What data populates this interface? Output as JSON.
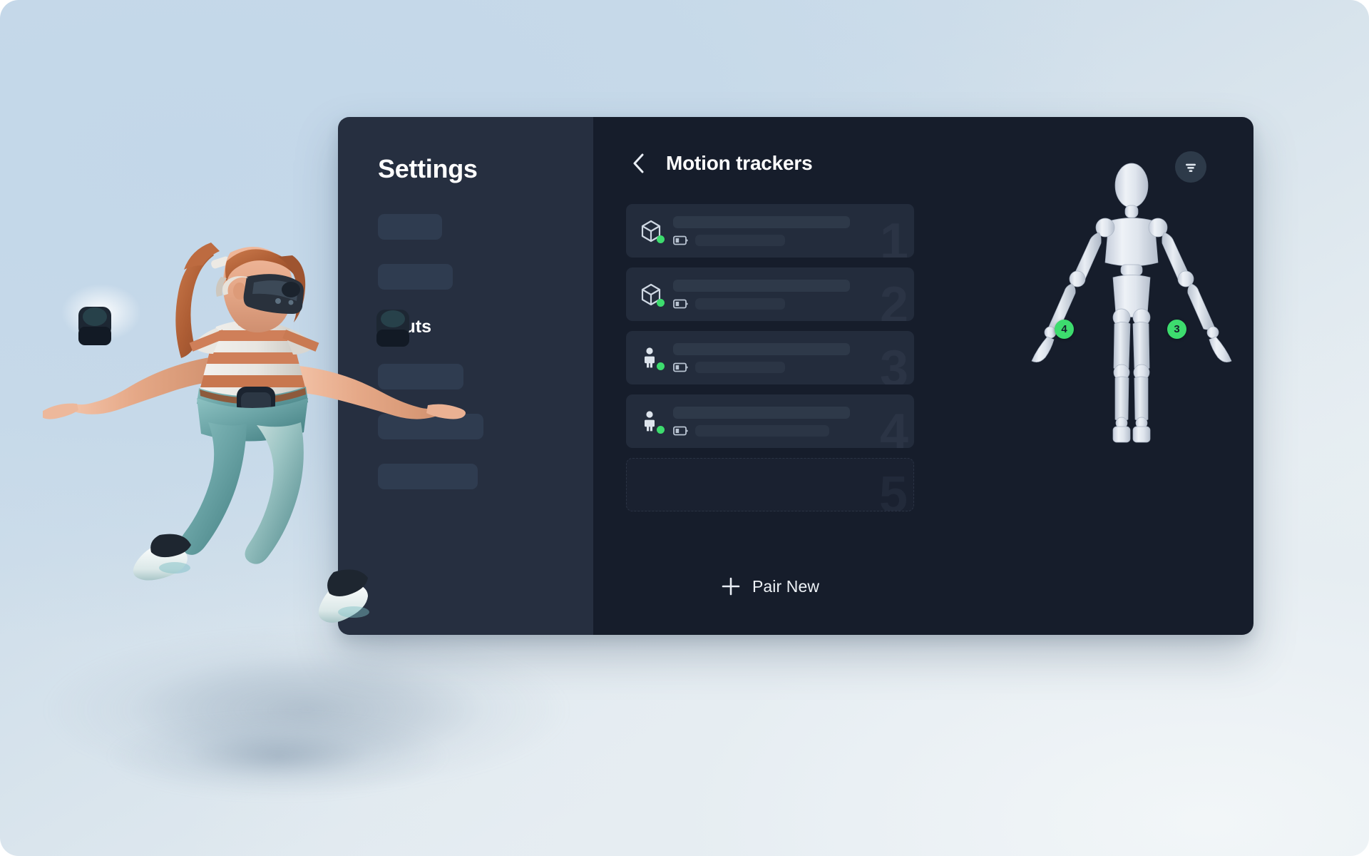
{
  "background": {
    "gradient_from": "#c4d8e9",
    "gradient_to": "#eef2f5"
  },
  "colors": {
    "panel_sidebar_bg": "#262f40",
    "panel_main_bg": "#161d2b",
    "list_item_bg": "#232c3c",
    "skeleton_bg": "#2f3c50",
    "status_green": "#3ddc6e",
    "number_ghost": "#2b3445",
    "text_primary": "#ffffff"
  },
  "sidebar": {
    "title": "Settings",
    "items": [
      {
        "label": "",
        "type": "skeleton",
        "name": "sidebar-item-skeleton-1"
      },
      {
        "label": "",
        "type": "skeleton",
        "name": "sidebar-item-skeleton-2"
      },
      {
        "label": "Inputs",
        "type": "label",
        "name": "sidebar-item-inputs"
      },
      {
        "label": "",
        "type": "skeleton",
        "name": "sidebar-item-skeleton-3"
      },
      {
        "label": "",
        "type": "skeleton",
        "name": "sidebar-item-skeleton-4"
      },
      {
        "label": "",
        "type": "skeleton",
        "name": "sidebar-item-skeleton-5"
      }
    ]
  },
  "main": {
    "back_icon": "chevron-left-icon",
    "title": "Motion trackers",
    "filter_icon": "filter-icon",
    "pair_new": {
      "icon": "plus-icon",
      "label": "Pair New"
    },
    "trackers": [
      {
        "number": "1",
        "icon": "cube-icon",
        "status": "connected",
        "status_color": "#3ddc6e",
        "name_value": "",
        "battery_icon": "battery-low-icon",
        "battery_value": "",
        "battery_width": 126,
        "empty": false
      },
      {
        "number": "2",
        "icon": "cube-icon",
        "status": "connected",
        "status_color": "#3ddc6e",
        "name_value": "",
        "battery_icon": "battery-low-icon",
        "battery_value": "",
        "battery_width": 126,
        "empty": false
      },
      {
        "number": "3",
        "icon": "person-icon",
        "status": "connected",
        "status_color": "#3ddc6e",
        "name_value": "",
        "battery_icon": "battery-low-icon",
        "battery_value": "",
        "battery_width": 126,
        "empty": false
      },
      {
        "number": "4",
        "icon": "person-icon",
        "status": "connected",
        "status_color": "#3ddc6e",
        "name_value": "",
        "battery_icon": "battery-low-icon",
        "battery_value": "",
        "battery_width": 188,
        "empty": false
      },
      {
        "number": "5",
        "icon": "",
        "status": "empty",
        "status_color": "",
        "name_value": "",
        "battery_icon": "",
        "battery_value": "",
        "battery_width": 0,
        "empty": true
      }
    ],
    "mannequin": {
      "alt": "3d mannequin body preview",
      "badges": [
        {
          "label": "4",
          "position": "left-elbow"
        },
        {
          "label": "3",
          "position": "right-elbow"
        }
      ]
    }
  },
  "avatar": {
    "alt": "vr user wearing headset and body trackers",
    "hair_color": "#b4643c",
    "shirt_stripe_color": "#cf7f59",
    "jeans_color": "#6fa7a8"
  }
}
